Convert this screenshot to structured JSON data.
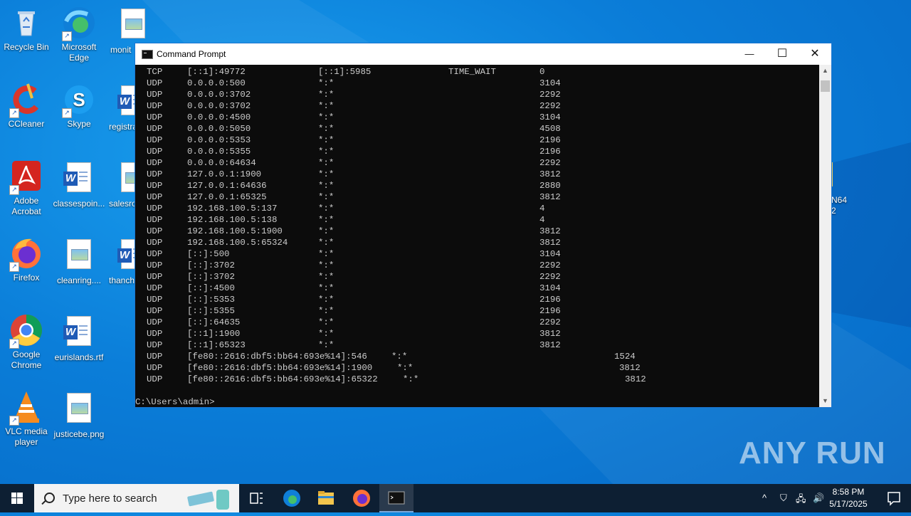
{
  "desktop": {
    "icons": [
      {
        "label": "Recycle Bin"
      },
      {
        "label": "Microsoft Edge"
      },
      {
        "label": "monit"
      },
      {
        "label": "CCleaner"
      },
      {
        "label": "Skype"
      },
      {
        "label": "registra"
      },
      {
        "label": "Adobe Acrobat"
      },
      {
        "label": "classespoin..."
      },
      {
        "label": "salesro"
      },
      {
        "label": "Firefox"
      },
      {
        "label": "cleanring...."
      },
      {
        "label": "thanch"
      },
      {
        "label": "Google Chrome"
      },
      {
        "label": "eurislands.rtf"
      },
      {
        "label": "VLC media player"
      },
      {
        "label": "justicebe.png"
      },
      {
        "label": "N64\n2"
      }
    ]
  },
  "window": {
    "title": "Command Prompt",
    "minimize_label": "—",
    "maximize_label": "☐",
    "close_label": "✕",
    "rows": [
      [
        "TCP",
        "[::1]:49772",
        "[::1]:5985",
        "TIME_WAIT",
        "0"
      ],
      [
        "UDP",
        "0.0.0.0:500",
        "*:*",
        "",
        "3104"
      ],
      [
        "UDP",
        "0.0.0.0:3702",
        "*:*",
        "",
        "2292"
      ],
      [
        "UDP",
        "0.0.0.0:3702",
        "*:*",
        "",
        "2292"
      ],
      [
        "UDP",
        "0.0.0.0:4500",
        "*:*",
        "",
        "3104"
      ],
      [
        "UDP",
        "0.0.0.0:5050",
        "*:*",
        "",
        "4508"
      ],
      [
        "UDP",
        "0.0.0.0:5353",
        "*:*",
        "",
        "2196"
      ],
      [
        "UDP",
        "0.0.0.0:5355",
        "*:*",
        "",
        "2196"
      ],
      [
        "UDP",
        "0.0.0.0:64634",
        "*:*",
        "",
        "2292"
      ],
      [
        "UDP",
        "127.0.0.1:1900",
        "*:*",
        "",
        "3812"
      ],
      [
        "UDP",
        "127.0.0.1:64636",
        "*:*",
        "",
        "2880"
      ],
      [
        "UDP",
        "127.0.0.1:65325",
        "*:*",
        "",
        "3812"
      ],
      [
        "UDP",
        "192.168.100.5:137",
        "*:*",
        "",
        "4"
      ],
      [
        "UDP",
        "192.168.100.5:138",
        "*:*",
        "",
        "4"
      ],
      [
        "UDP",
        "192.168.100.5:1900",
        "*:*",
        "",
        "3812"
      ],
      [
        "UDP",
        "192.168.100.5:65324",
        "*:*",
        "",
        "3812"
      ],
      [
        "UDP",
        "[::]:500",
        "*:*",
        "",
        "3104"
      ],
      [
        "UDP",
        "[::]:3702",
        "*:*",
        "",
        "2292"
      ],
      [
        "UDP",
        "[::]:3702",
        "*:*",
        "",
        "2292"
      ],
      [
        "UDP",
        "[::]:4500",
        "*:*",
        "",
        "3104"
      ],
      [
        "UDP",
        "[::]:5353",
        "*:*",
        "",
        "2196"
      ],
      [
        "UDP",
        "[::]:5355",
        "*:*",
        "",
        "2196"
      ],
      [
        "UDP",
        "[::]:64635",
        "*:*",
        "",
        "2292"
      ],
      [
        "UDP",
        "[::1]:1900",
        "*:*",
        "",
        "3812"
      ],
      [
        "UDP",
        "[::1]:65323",
        "*:*",
        "",
        "3812"
      ]
    ],
    "long_rows": [
      [
        "UDP",
        "[fe80::2616:dbf5:bb64:693e%14]:546",
        "*:*",
        "1524"
      ],
      [
        "UDP",
        "[fe80::2616:dbf5:bb64:693e%14]:1900",
        "*:*",
        "3812"
      ],
      [
        "UDP",
        "[fe80::2616:dbf5:bb64:693e%14]:65322",
        "*:*",
        "3812"
      ]
    ],
    "prompt": "C:\\Users\\admin>"
  },
  "taskbar": {
    "search_placeholder": "Type here to search",
    "time": "8:58 PM",
    "date": "5/17/2025"
  },
  "watermark": "ANY RUN",
  "colors": {
    "desktop": "#0b7ed9",
    "console_bg": "#0c0c0c",
    "console_text": "#cccccc",
    "taskbar": "#0d1f33"
  }
}
